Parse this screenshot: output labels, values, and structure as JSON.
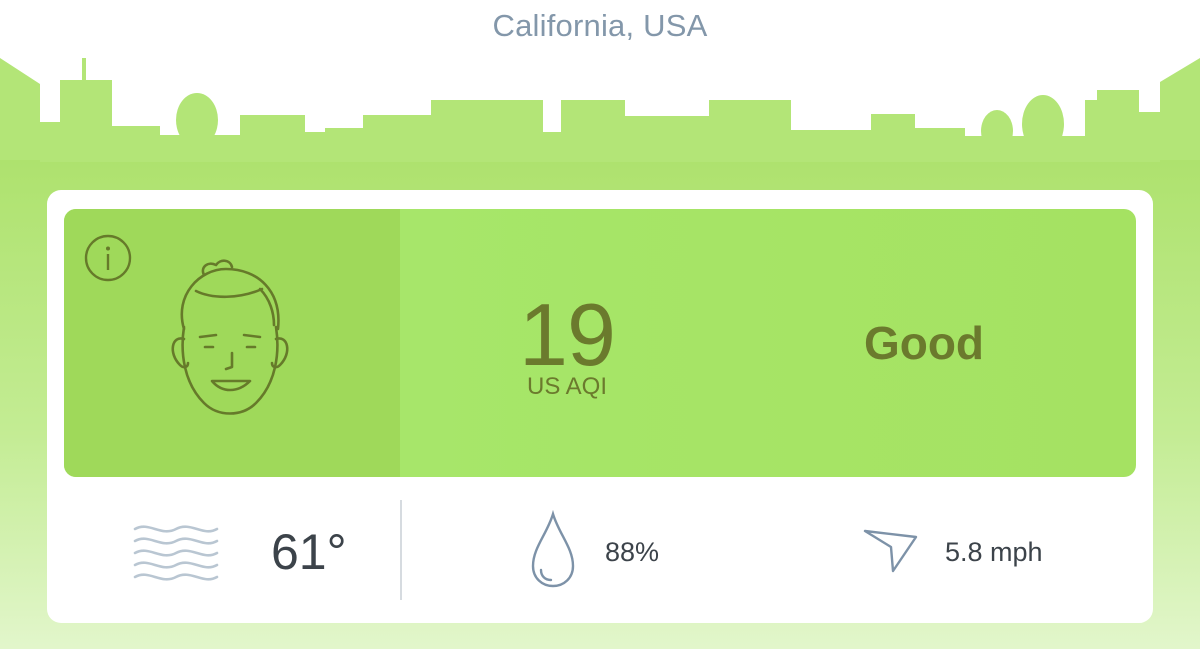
{
  "header": {
    "location": "California, USA"
  },
  "aqi": {
    "value": "19",
    "unit": "US AQI",
    "status": "Good"
  },
  "weather": {
    "temperature": "61°",
    "humidity": "88%",
    "wind": "5.8 mph"
  },
  "icons": {
    "info": "info-circle-icon",
    "face": "smiling-face-icon",
    "temperature": "wavy-lines-icon",
    "humidity": "water-drop-icon",
    "wind": "wind-direction-arrow-icon"
  },
  "colors": {
    "skyline": "#b3e577",
    "panel": "#a6e567",
    "face_box": "#9fd95a",
    "aqi_text": "#6b7a2d",
    "location_text": "#8397aa"
  }
}
